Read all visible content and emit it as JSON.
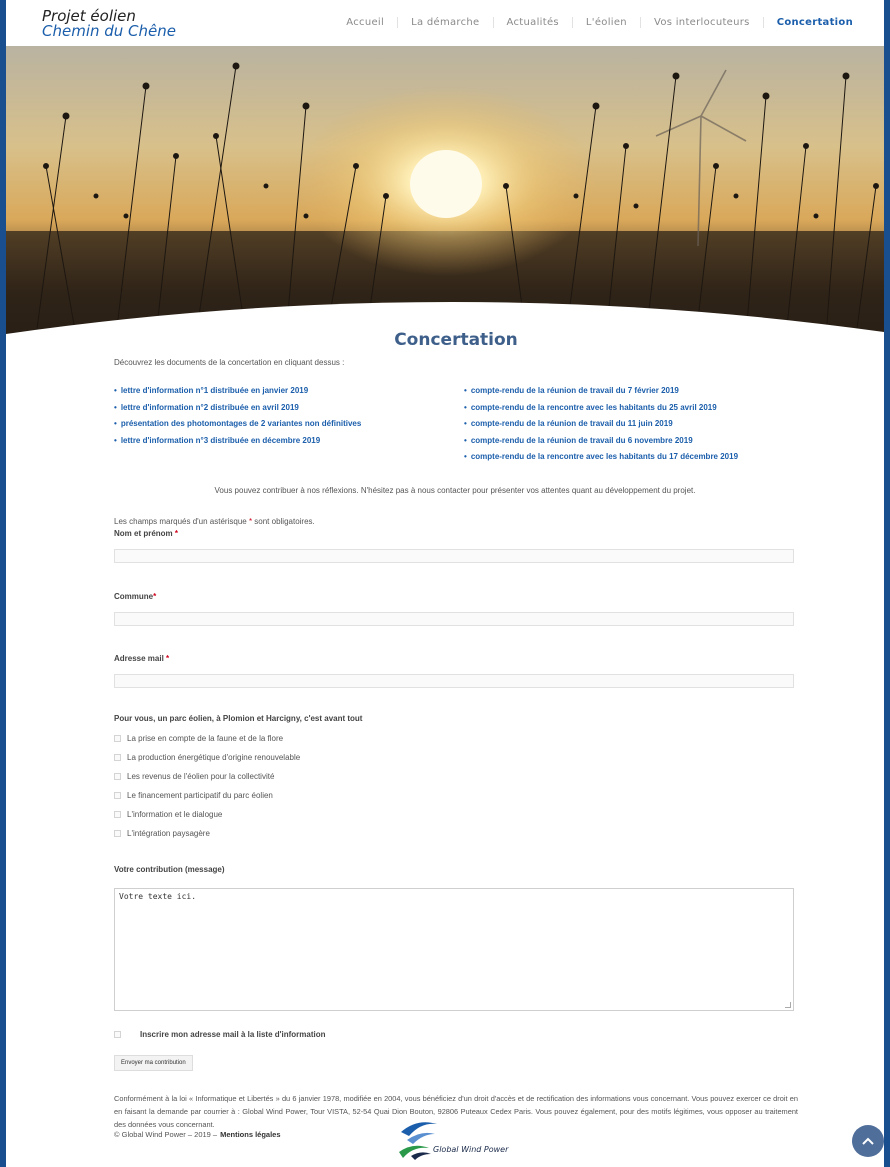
{
  "header": {
    "logo_line1": "Projet éolien",
    "logo_line2": "Chemin du Chêne",
    "nav": [
      "Accueil",
      "La démarche",
      "Actualités",
      "L'éolien",
      "Vos interlocuteurs",
      "Concertation"
    ],
    "active_nav": "Concertation"
  },
  "main": {
    "title": "Concertation",
    "intro": "Découvrez les documents de la concertation en cliquant dessus :",
    "docs_left": [
      "lettre d'information n°1 distribuée en janvier 2019",
      "lettre d'information n°2 distribuée en avril 2019",
      "présentation des photomontages de 2 variantes non définitives",
      "lettre d'information n°3 distribuée en décembre 2019"
    ],
    "docs_right": [
      "compte-rendu de la réunion de travail du 7 février 2019",
      "compte-rendu de la rencontre avec les habitants du 25 avril 2019",
      "compte-rendu de la réunion de travail du 11 juin 2019",
      "compte-rendu de la réunion de travail du 6 novembre 2019",
      "compte-rendu de la rencontre avec les habitants du 17 décembre 2019"
    ],
    "contribute_text": "Vous pouvez contribuer à nos réflexions. N'hésitez pas à nous contacter pour présenter vos attentes quant au développement du projet."
  },
  "form": {
    "required_note_before": "Les champs marqués d'un astérisque ",
    "required_star": "*",
    "required_note_after": " sont obligatoires.",
    "name_label": "Nom et prénom",
    "commune_label": "Commune",
    "email_label": "Adresse mail",
    "question": "Pour vous, un parc éolien, à Plomion et Harcigny, c'est avant tout",
    "options": [
      "La prise en compte de la faune et de la flore",
      "La production énergétique d'origine renouvelable",
      "Les revenus de l'éolien pour la collectivité",
      "Le financement participatif du parc éolien",
      "L'information et le dialogue",
      "L'intégration paysagère"
    ],
    "message_label": "Votre contribution (message)",
    "message_value": "Votre texte ici.",
    "newsletter_label": "Inscrire mon adresse mail à la liste d'information",
    "submit_label": "Envoyer ma contribution"
  },
  "legal": {
    "text": "Conformément à la loi « Informatique et Libertés » du 6 janvier 1978, modifiée en 2004, vous bénéficiez d'un droit d'accès et de rectification des informations vous concernant. Vous pouvez exercer ce droit en en faisant la demande par courrier à : Global Wind Power, Tour VISTA, 52-54 Quai Dion Bouton, 92806 Puteaux Cedex Paris. Vous pouvez également, pour des motifs légitimes, vous opposer au traitement des données vous concernant."
  },
  "footer": {
    "copyright": "© Global Wind Power – 2019 –",
    "mentions": "Mentions légales",
    "brand": "Global Wind Power"
  },
  "colors": {
    "accent": "#1b5eab",
    "frame": "#1a4f8f",
    "required": "#d0021b"
  },
  "icons": {
    "scroll_top": "chevron-up-icon",
    "brand_logo": "global-wind-power-logo"
  }
}
